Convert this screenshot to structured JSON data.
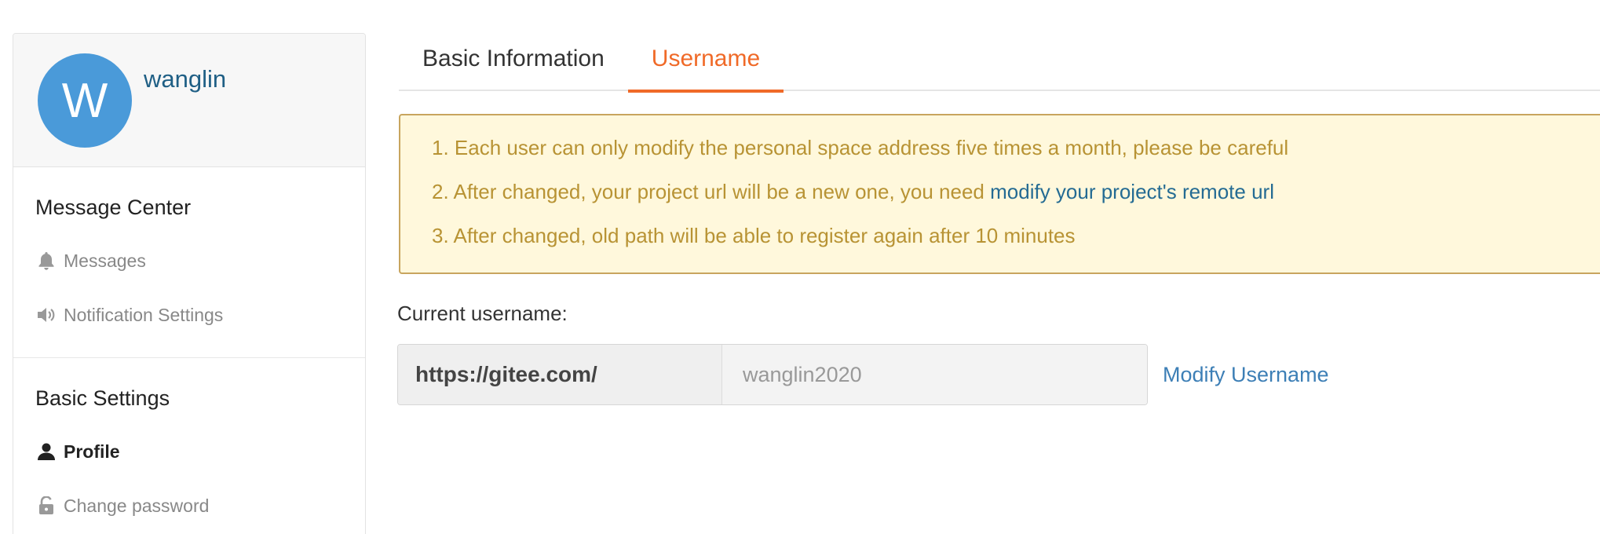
{
  "sidebar": {
    "avatar_initial": "W",
    "user_name": "wanglin",
    "sections": [
      {
        "title": "Message Center",
        "items": [
          {
            "label": "Messages",
            "icon": "bell-icon"
          },
          {
            "label": "Notification Settings",
            "icon": "speaker-icon"
          }
        ]
      },
      {
        "title": "Basic Settings",
        "items": [
          {
            "label": "Profile",
            "icon": "user-icon",
            "active": true
          },
          {
            "label": "Change password",
            "icon": "unlock-icon"
          }
        ]
      }
    ]
  },
  "tabs": [
    {
      "label": "Basic Information",
      "active": false
    },
    {
      "label": "Username",
      "active": true
    }
  ],
  "notice": {
    "line1": "1. Each user can only modify the personal space address five times a month, please be careful",
    "line2_prefix": "2. After changed, your project url will be a new one, you need ",
    "line2_link": "modify your project's remote url",
    "line3": "3. After changed, old path will be able to register again after 10 minutes"
  },
  "form": {
    "current_label": "Current username:",
    "url_prefix": "https://gitee.com/",
    "username_value": "wanglin2020",
    "modify_label": "Modify Username"
  },
  "colors": {
    "accent": "#f06a28",
    "avatar": "#4a9ad9",
    "link": "#3d7fb6",
    "notice_bg": "#fff8dc",
    "notice_text": "#b89334"
  }
}
